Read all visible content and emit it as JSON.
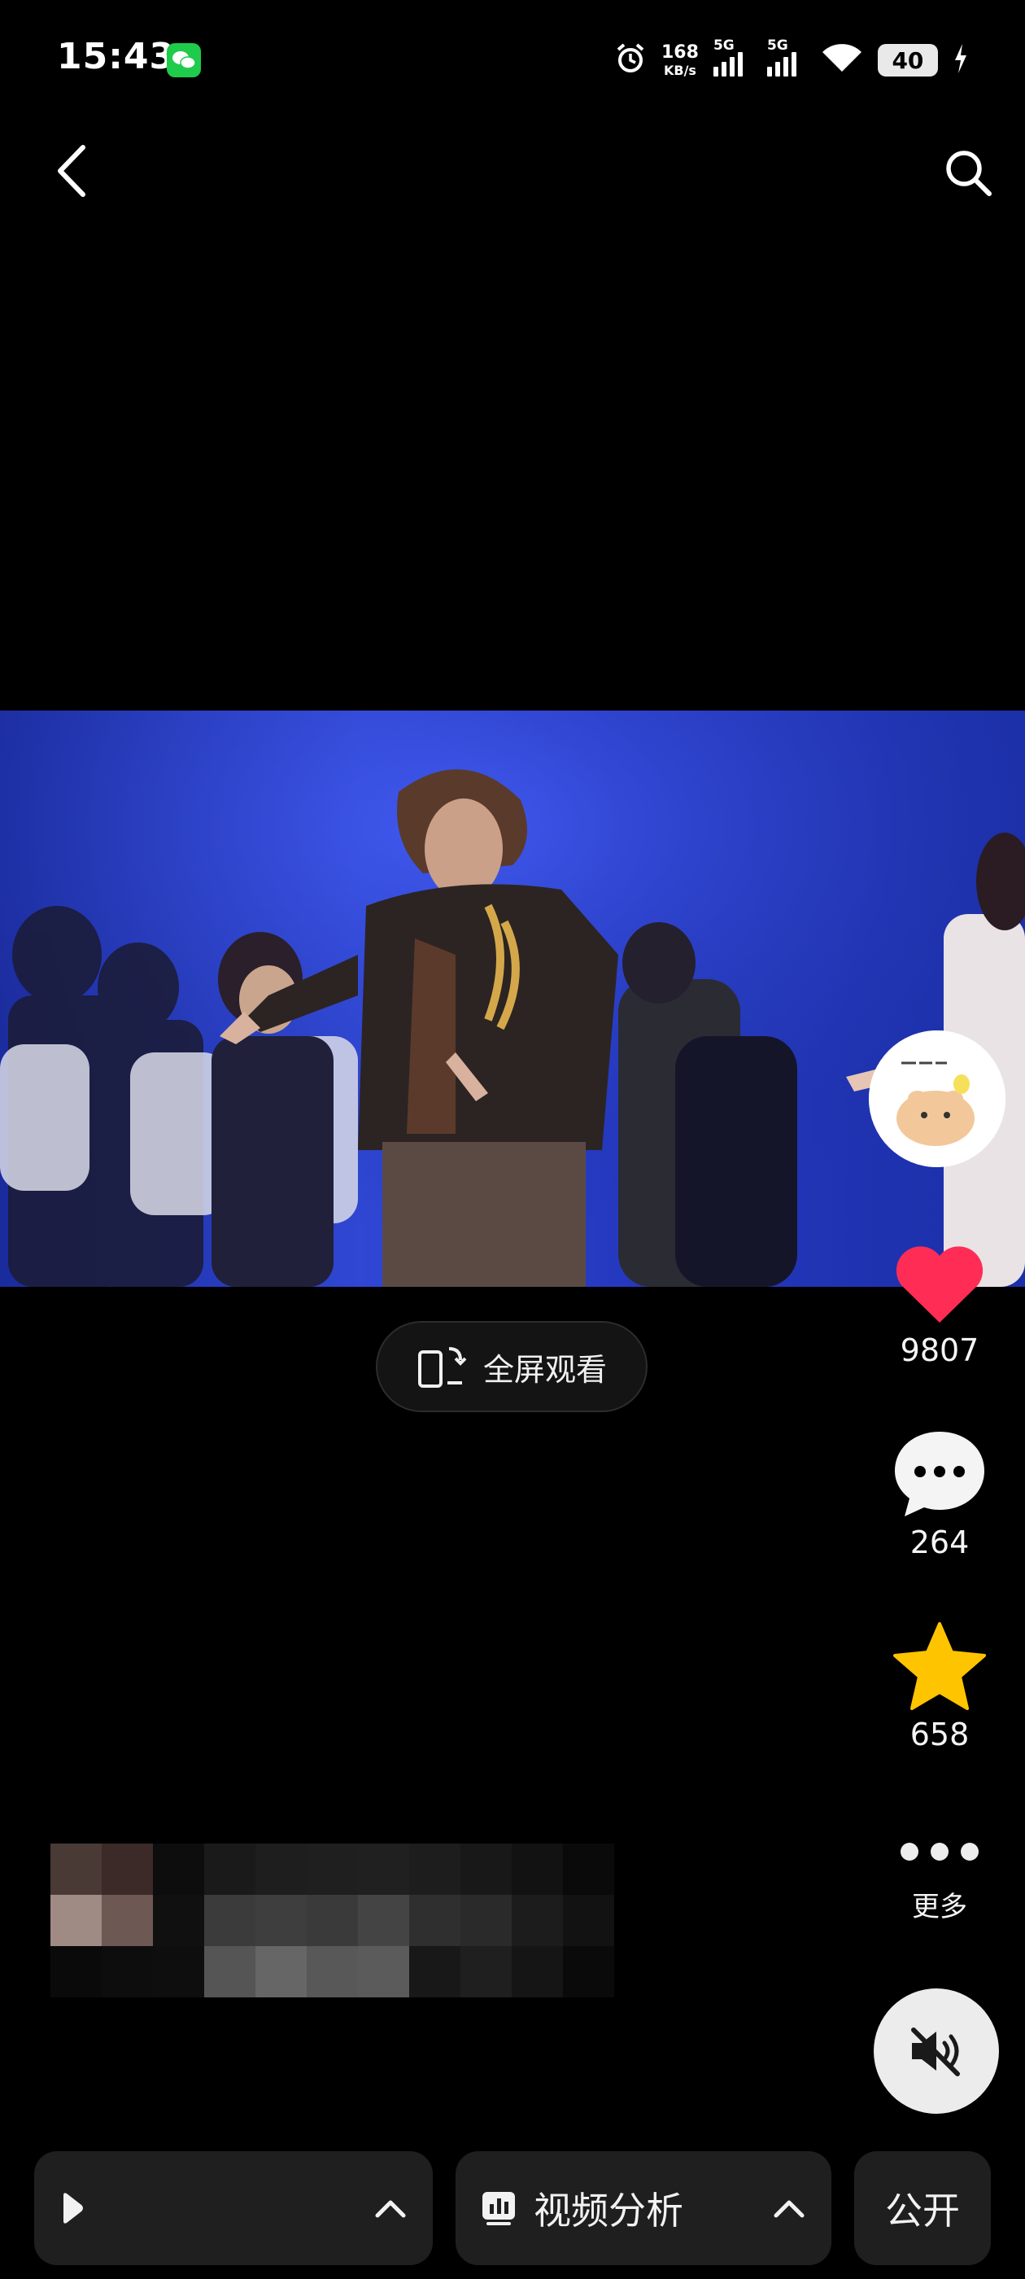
{
  "status_bar": {
    "time": "15:43",
    "speed_value": "168",
    "speed_unit": "KB/s",
    "signal1_label": "5G",
    "signal2_label": "5G",
    "battery": "40"
  },
  "counts": {
    "likes": "9807",
    "comments": "264",
    "favorites": "658",
    "more_label": "更多"
  },
  "fullscreen_label": "全屏观看",
  "bottom_bar": {
    "analysis_label": "视频分析",
    "visibility_label": "公开"
  },
  "colors": {
    "like_red": "#ff2d55",
    "favorite_yellow": "#ffc400",
    "stage_blue": "#2f47d3"
  }
}
